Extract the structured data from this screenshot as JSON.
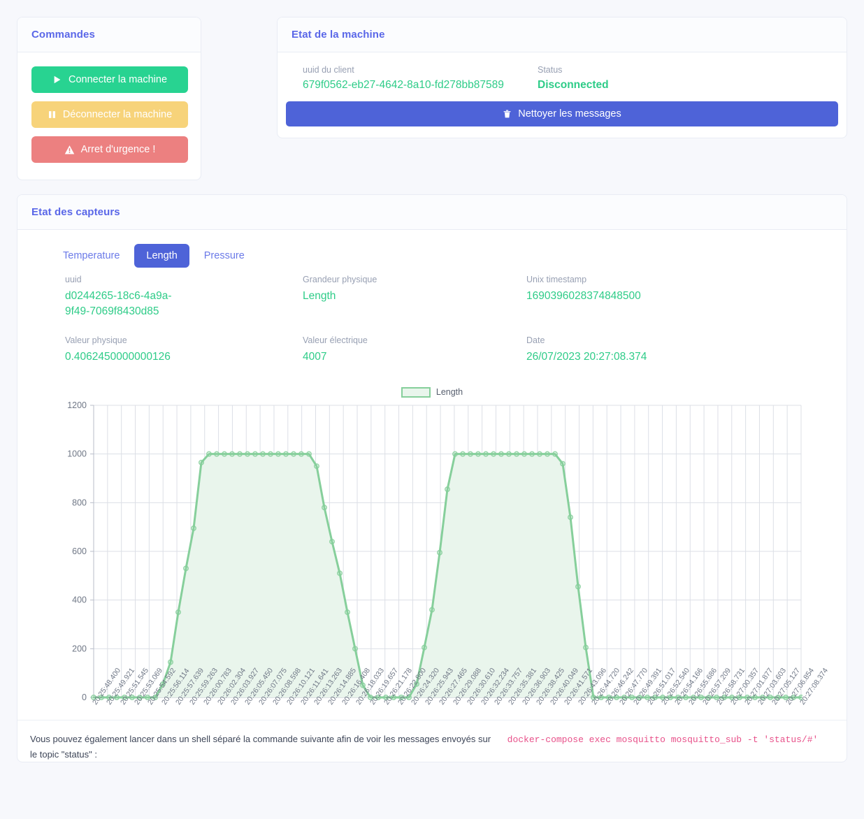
{
  "commands": {
    "title": "Commandes",
    "buttons": [
      {
        "label": "Connecter la machine",
        "icon": "play-icon",
        "color": "#28d391"
      },
      {
        "label": "Déconnecter la machine",
        "icon": "pause-icon",
        "color": "#f7d37a"
      },
      {
        "label": "Arret d'urgence !",
        "icon": "warning-icon",
        "color": "#ec8080"
      }
    ]
  },
  "machine": {
    "title": "Etat de la machine",
    "uuid_label": "uuid du client",
    "uuid_value": "679f0562-eb27-4642-8a10-fd278bb87589",
    "status_label": "Status",
    "status_value": "Disconnected",
    "clean_button": "Nettoyer les messages",
    "clean_icon": "trash-icon"
  },
  "sensors": {
    "title": "Etat des capteurs",
    "tabs": [
      {
        "label": "Temperature",
        "active": false
      },
      {
        "label": "Length",
        "active": true
      },
      {
        "label": "Pressure",
        "active": false
      }
    ],
    "fields": {
      "uuid_label": "uuid",
      "uuid_value": "d0244265-18c6-4a9a-9f49-7069f8430d85",
      "quantity_label": "Grandeur physique",
      "quantity_value": "Length",
      "timestamp_label": "Unix timestamp",
      "timestamp_value": "1690396028374848500",
      "physical_label": "Valeur physique",
      "physical_value": "0.4062450000000126",
      "electric_label": "Valeur électrique",
      "electric_value": "4007",
      "date_label": "Date",
      "date_value": "26/07/2023 20:27:08.374"
    }
  },
  "note": {
    "text": "Vous pouvez également lancer dans un shell séparé la commande suivante afin de voir les messages envoyés sur le topic \"status\" :",
    "command": "docker-compose exec mosquitto mosquitto_sub -t 'status/#'"
  },
  "colors": {
    "accent": "#5a67e8",
    "value_green": "#2ecc88",
    "series_line": "#86cf9b",
    "series_fill": "#e9f5ec",
    "primary_button": "#4e63d8",
    "code": "#e8518a"
  },
  "chart_data": {
    "type": "area",
    "title": "",
    "xlabel": "",
    "ylabel": "",
    "ylim": [
      0,
      1200
    ],
    "yticks": [
      0,
      200,
      400,
      600,
      800,
      1000,
      1200
    ],
    "grid": true,
    "legend_position": "top-center",
    "series": [
      {
        "name": "Length",
        "line_color": "#86cf9b",
        "fill_color": "#e9f5ec",
        "values": [
          0,
          0,
          0,
          0,
          0,
          0,
          0,
          0,
          0,
          55,
          145,
          350,
          530,
          695,
          965,
          1000,
          1000,
          1000,
          1000,
          1000,
          1000,
          1000,
          1000,
          1000,
          1000,
          1000,
          1000,
          1000,
          1000,
          950,
          780,
          640,
          510,
          350,
          200,
          50,
          0,
          0,
          0,
          0,
          0,
          0,
          55,
          205,
          360,
          595,
          855,
          1000,
          1000,
          1000,
          1000,
          1000,
          1000,
          1000,
          1000,
          1000,
          1000,
          1000,
          1000,
          1000,
          1000,
          960,
          740,
          455,
          205,
          0,
          0,
          0,
          0,
          0,
          0,
          0,
          0,
          0,
          0,
          0,
          0,
          0,
          0,
          0,
          0,
          0,
          0,
          0,
          0,
          0,
          0,
          0,
          0,
          0,
          0,
          0,
          0
        ]
      }
    ],
    "categories": [
      "20:25:48.400",
      "20:25:49.921",
      "20:25:51.545",
      "20:25:53.069",
      "20:25:54.592",
      "20:25:56.114",
      "20:25:57.639",
      "20:25:59.263",
      "20:26:00.783",
      "20:26:02.304",
      "20:26:03.927",
      "20:26:05.450",
      "20:26:07.075",
      "20:26:08.598",
      "20:26:10.121",
      "20:26:11.641",
      "20:26:13.263",
      "20:26:14.885",
      "20:26:16.408",
      "20:26:18.033",
      "20:26:19.657",
      "20:26:21.178",
      "20:26:22.800",
      "20:26:24.320",
      "20:26:25.943",
      "20:26:27.465",
      "20:26:29.088",
      "20:26:30.610",
      "20:26:32.234",
      "20:26:33.757",
      "20:26:35.381",
      "20:26:36.903",
      "20:26:38.425",
      "20:26:40.049",
      "20:26:41.571",
      "20:26:43.096",
      "20:26:44.720",
      "20:26:46.242",
      "20:26:47.770",
      "20:26:49.391",
      "20:26:51.017",
      "20:26:52.540",
      "20:26:54.166",
      "20:26:55.686",
      "20:26:57.209",
      "20:26:58.731",
      "20:27:00.357",
      "20:27:01.877",
      "20:27:03.603",
      "20:27:05.127",
      "20:27:06.854",
      "20:27:08.374"
    ]
  }
}
